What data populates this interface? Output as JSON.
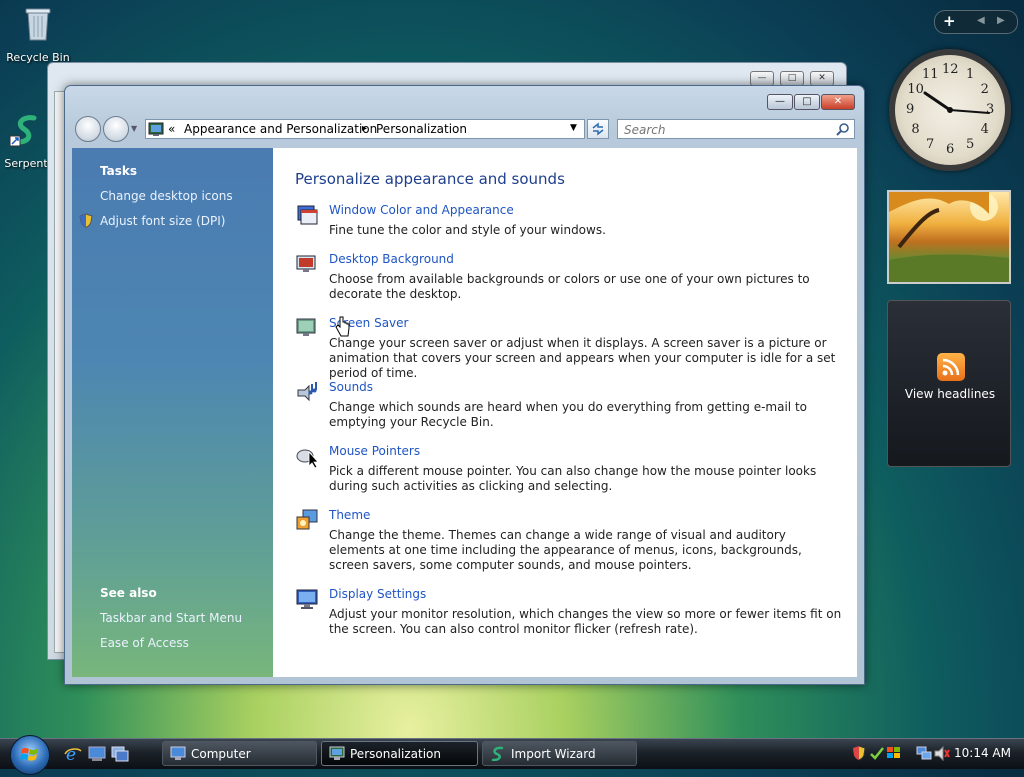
{
  "desktop": {
    "icons": [
      {
        "label": "Recycle Bin"
      },
      {
        "label": "Serpent"
      }
    ]
  },
  "sidebar": {
    "clock_numbers": [
      "12",
      "1",
      "2",
      "3",
      "4",
      "5",
      "6",
      "7",
      "8",
      "9",
      "10",
      "11"
    ],
    "feeds_label": "View headlines"
  },
  "window": {
    "address": {
      "chevron": "«",
      "crumb1": "Appearance and Personalization",
      "separator": "▸",
      "crumb2": "Personalization",
      "dropdown": "▼"
    },
    "search_placeholder": "Search",
    "left": {
      "tasks_heading": "Tasks",
      "tasks": [
        "Change desktop icons",
        "Adjust font size (DPI)"
      ],
      "see_also_heading": "See also",
      "see_also": [
        "Taskbar and Start Menu",
        "Ease of Access"
      ]
    },
    "main": {
      "title": "Personalize appearance and sounds",
      "items": [
        {
          "title": "Window Color and Appearance",
          "desc": "Fine tune the color and style of your windows."
        },
        {
          "title": "Desktop Background",
          "desc": "Choose from available backgrounds or colors or use one of your own pictures to decorate the desktop."
        },
        {
          "title": "Screen Saver",
          "desc": "Change your screen saver or adjust when it displays. A screen saver is a picture or animation that covers your screen and appears when your computer is idle for a set period of time."
        },
        {
          "title": "Sounds",
          "desc": "Change which sounds are heard when you do everything from getting e-mail to emptying your Recycle Bin."
        },
        {
          "title": "Mouse Pointers",
          "desc": "Pick a different mouse pointer. You can also change how the mouse pointer looks during such activities as clicking and selecting."
        },
        {
          "title": "Theme",
          "desc": "Change the theme. Themes can change a wide range of visual and auditory elements at one time including the appearance of menus, icons, backgrounds, screen savers, some computer sounds, and mouse pointers."
        },
        {
          "title": "Display Settings",
          "desc": "Adjust your monitor resolution, which changes the view so more or fewer items fit on the screen. You can also control monitor flicker (refresh rate)."
        }
      ]
    }
  },
  "taskbar": {
    "buttons": [
      {
        "label": "Computer"
      },
      {
        "label": "Personalization"
      },
      {
        "label": "Import Wizard"
      }
    ],
    "time": "10:14 AM"
  },
  "colors": {
    "link": "#1f55c3",
    "heading": "#1e3f8c",
    "left_pane_top": "#4a7bb1",
    "left_pane_bottom": "#78b67c"
  }
}
